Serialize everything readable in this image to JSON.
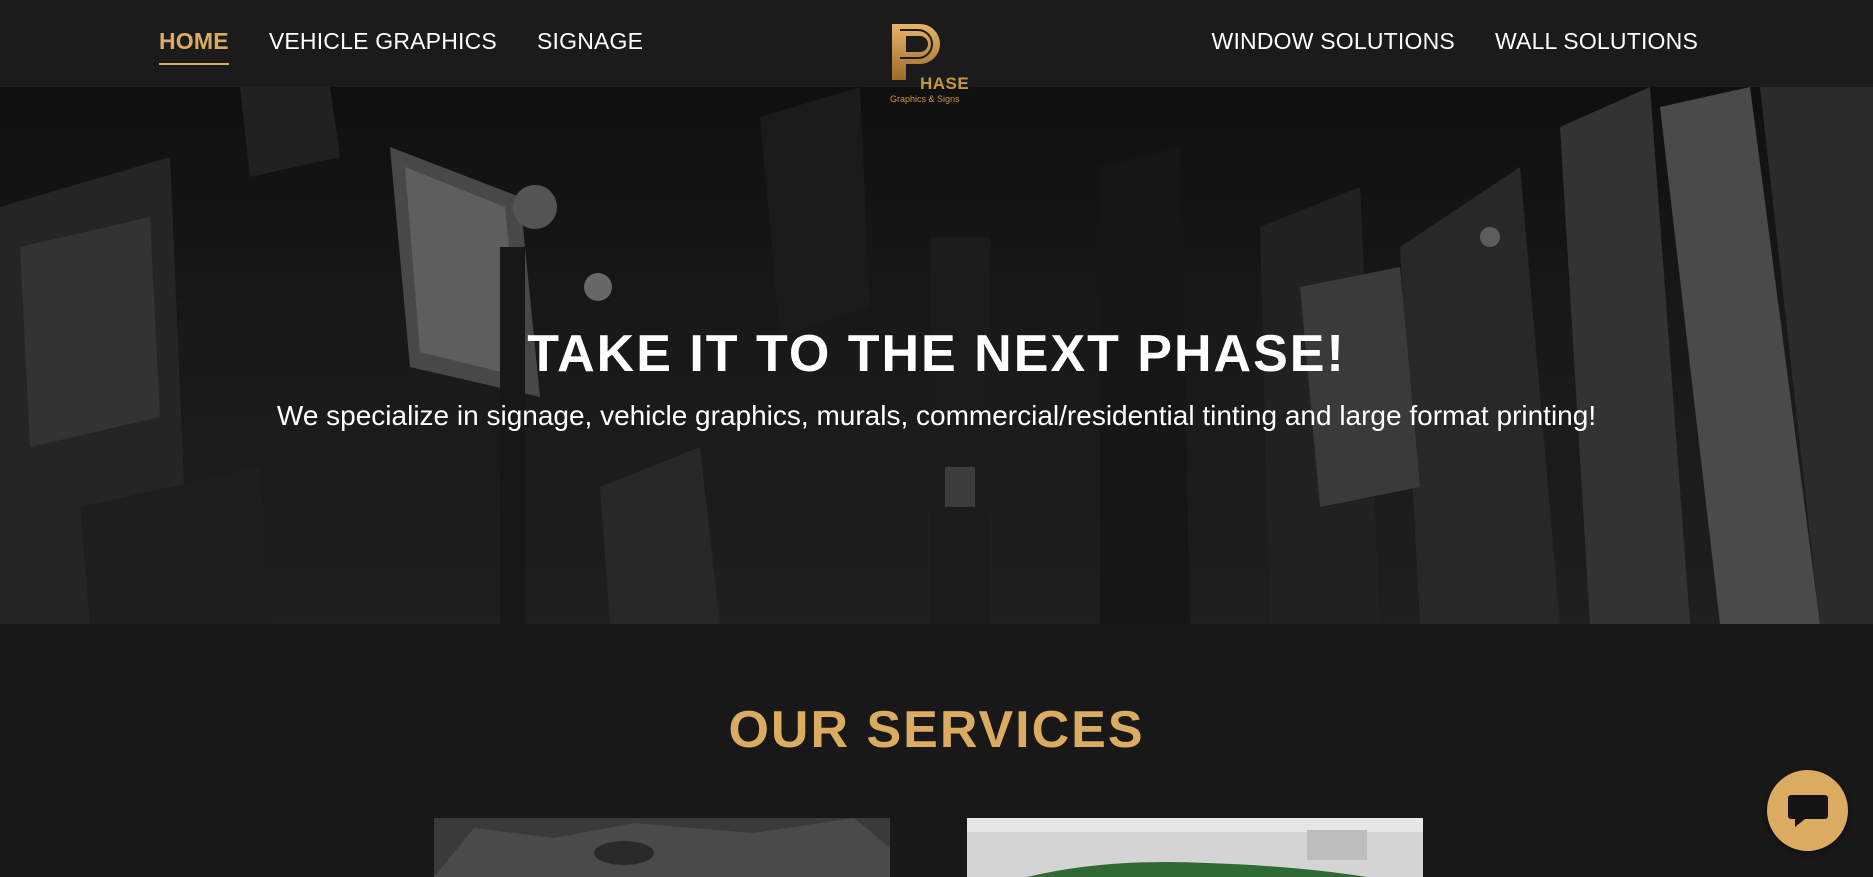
{
  "nav": {
    "left_items": [
      {
        "label": "HOME",
        "active": true
      },
      {
        "label": "VEHICLE GRAPHICS",
        "active": false
      },
      {
        "label": "SIGNAGE",
        "active": false
      }
    ],
    "right_items": [
      {
        "label": "WINDOW SOLUTIONS",
        "active": false
      },
      {
        "label": "WALL SOLUTIONS",
        "active": false
      }
    ]
  },
  "logo": {
    "wordmark": "HASE",
    "tagline": "Graphics & Signs"
  },
  "hero": {
    "title": "TAKE IT TO THE NEXT PHASE!",
    "subtitle": "We specialize in signage, vehicle graphics, murals, commercial/residential tinting and large format printing!"
  },
  "services": {
    "title": "OUR SERVICES"
  },
  "chat": {
    "icon": "chat-bubble-icon"
  },
  "colors": {
    "accent": "#dcab62",
    "background": "#181818",
    "nav_background": "#1b1b1b"
  }
}
